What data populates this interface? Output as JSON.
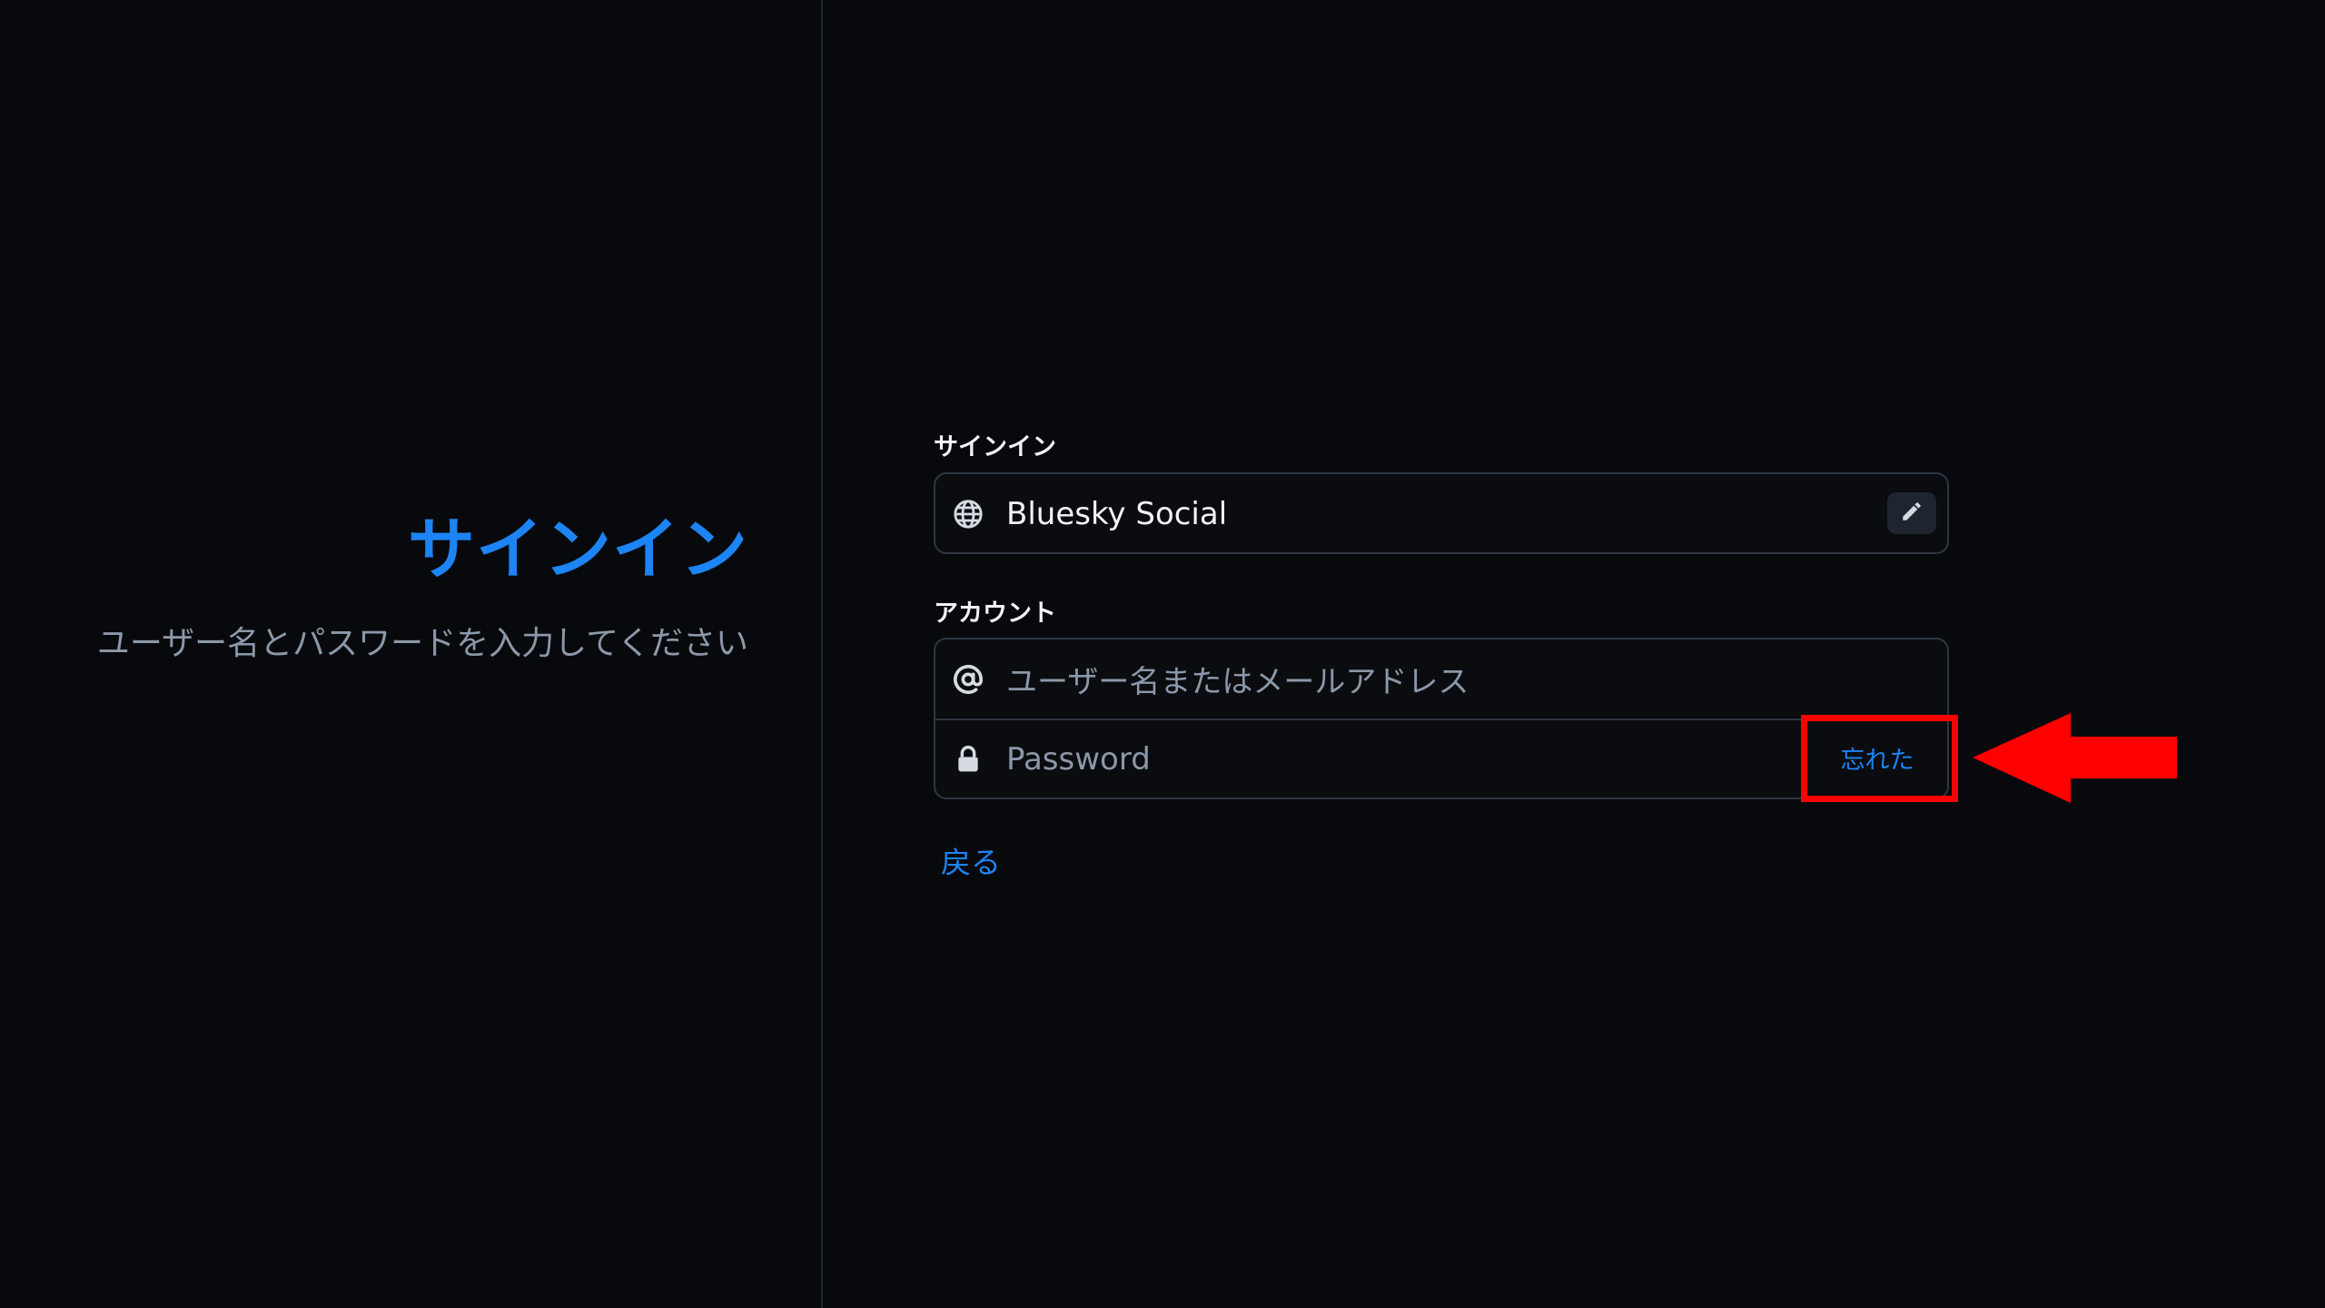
{
  "left_panel": {
    "title": "サインイン",
    "subtitle": "ユーザー名とパスワードを入力してください"
  },
  "form": {
    "signin_section_label": "サインイン",
    "provider": {
      "value": "Bluesky Social",
      "icon": "globe-icon",
      "edit_icon": "pencil-icon"
    },
    "account_section_label": "アカウント",
    "username": {
      "placeholder": "ユーザー名またはメールアドレス",
      "icon": "at-icon"
    },
    "password": {
      "placeholder": "Password",
      "icon": "lock-icon",
      "forgot_label": "忘れた"
    },
    "back_label": "戻る"
  },
  "annotation": {
    "highlight_color": "#ff0000",
    "arrow_color": "#ff0000"
  },
  "colors": {
    "background": "#08090c",
    "accent": "#1d84f5",
    "text": "#f1f3f5",
    "muted_text": "#8b98a9",
    "border": "#2e3642"
  }
}
